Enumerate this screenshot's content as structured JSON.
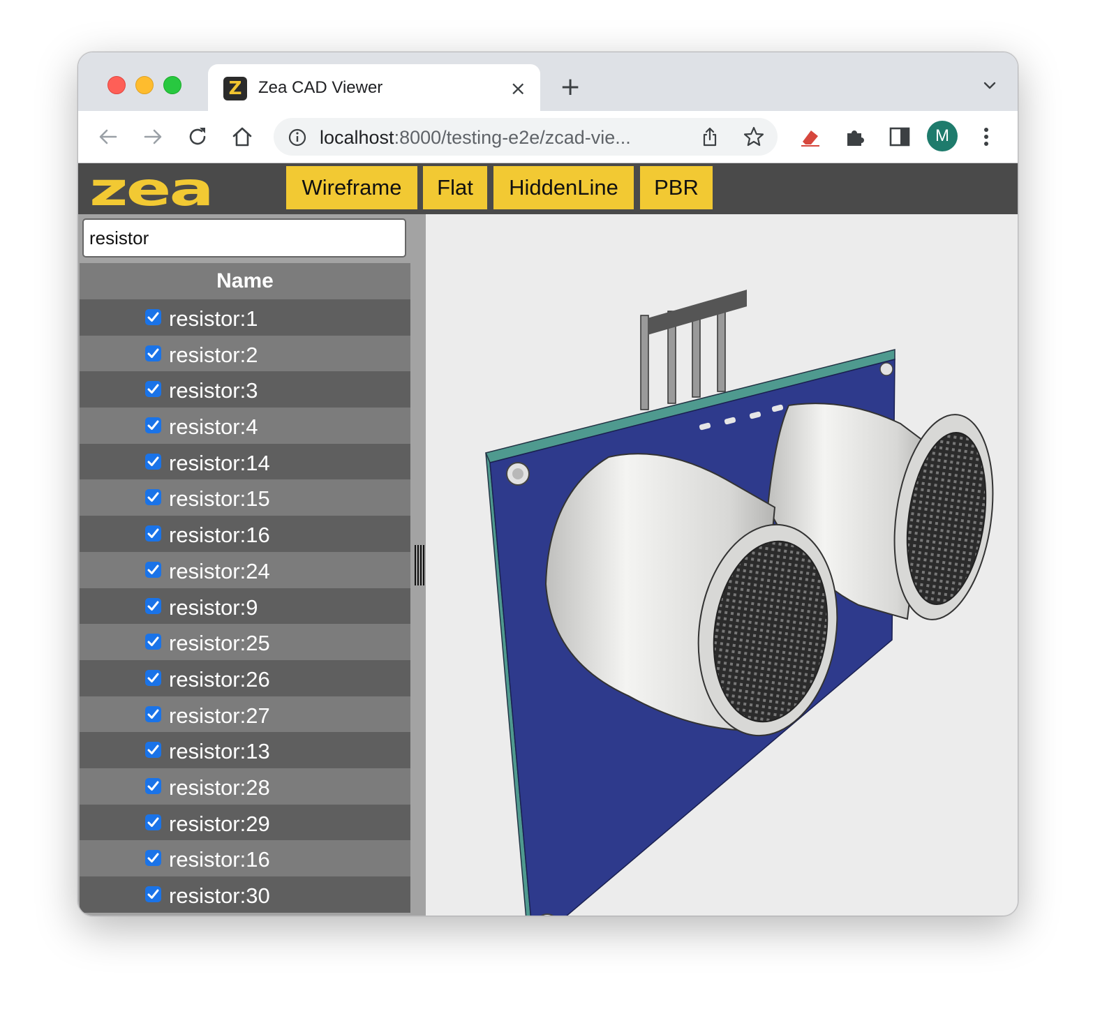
{
  "browser": {
    "tab_title": "Zea CAD Viewer",
    "tab_favicon_letter": "Z",
    "tab_close": "×",
    "new_tab": "+",
    "url_host": "localhost",
    "url_rest": ":8000/testing-e2e/zcad-vie...",
    "profile_initial": "M",
    "icons": [
      "back-icon",
      "forward-icon",
      "reload-icon",
      "home-icon",
      "site-info-icon",
      "share-icon",
      "star-icon",
      "eraser-extension-icon",
      "extensions-icon",
      "side-panel-icon",
      "more-menu-icon",
      "tab-list-chevron-icon"
    ]
  },
  "app": {
    "logo_text": "zea",
    "modes": [
      "Wireframe",
      "Flat",
      "HiddenLine",
      "PBR"
    ],
    "accent": "#f2c933",
    "header_bg": "#4a4a4a"
  },
  "sidebar": {
    "search_value": "resistor",
    "column_header": "Name",
    "items": [
      {
        "label": "resistor:1",
        "checked": true
      },
      {
        "label": "resistor:2",
        "checked": true
      },
      {
        "label": "resistor:3",
        "checked": true
      },
      {
        "label": "resistor:4",
        "checked": true
      },
      {
        "label": "resistor:14",
        "checked": true
      },
      {
        "label": "resistor:15",
        "checked": true
      },
      {
        "label": "resistor:16",
        "checked": true
      },
      {
        "label": "resistor:24",
        "checked": true
      },
      {
        "label": "resistor:9",
        "checked": true
      },
      {
        "label": "resistor:25",
        "checked": true
      },
      {
        "label": "resistor:26",
        "checked": true
      },
      {
        "label": "resistor:27",
        "checked": true
      },
      {
        "label": "resistor:13",
        "checked": true
      },
      {
        "label": "resistor:28",
        "checked": true
      },
      {
        "label": "resistor:29",
        "checked": true
      },
      {
        "label": "resistor:16",
        "checked": true
      },
      {
        "label": "resistor:30",
        "checked": true
      }
    ]
  },
  "viewport": {
    "model": "ultrasonic-sensor-module",
    "board_color": "#2e3a8c",
    "edge_color": "#4f9a8f",
    "transducer_color": "#e8e8e6"
  }
}
